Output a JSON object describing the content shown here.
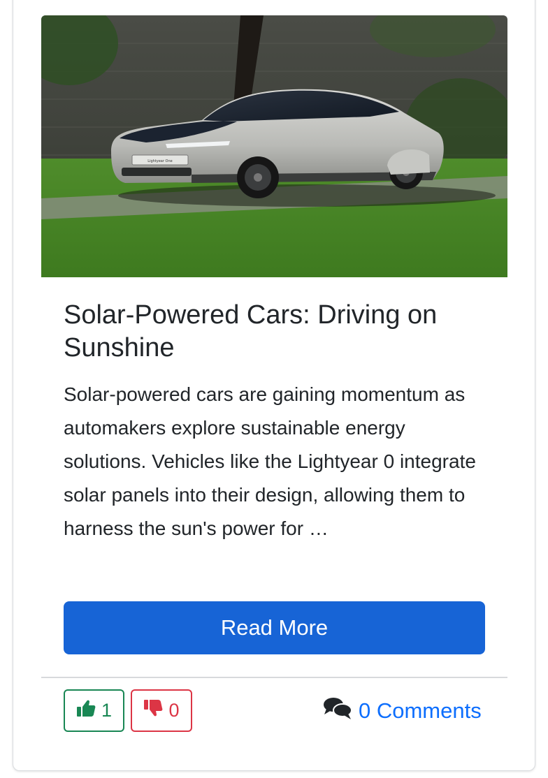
{
  "post": {
    "title": "Solar-Powered Cars: Driving on Sunshine",
    "excerpt": "Solar-powered cars are gaining momentum as automakers explore sustainable energy solutions. Vehicles like the Lightyear 0 integrate solar panels into their design, allowing them to harness the sun's power for …",
    "image": {
      "alt": "Lightyear One solar-powered car parked on grass",
      "plate_text": "Lightyear One"
    },
    "read_more_label": "Read More"
  },
  "votes": {
    "likes": "1",
    "dislikes": "0",
    "like_icon": "thumbs-up-icon",
    "dislike_icon": "thumbs-down-icon"
  },
  "comments": {
    "label": "0 Comments",
    "icon": "comments-icon"
  },
  "colors": {
    "primary": "#1764d6",
    "success": "#198754",
    "danger": "#dc3545",
    "link": "#0d6efd",
    "text": "#212529"
  }
}
